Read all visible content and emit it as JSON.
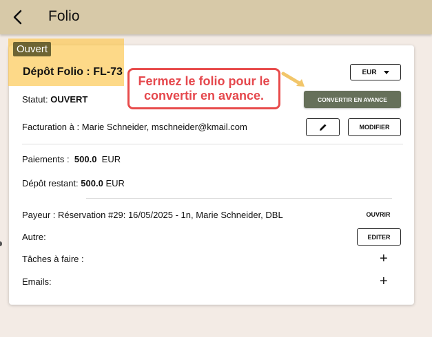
{
  "app": {
    "title": "Folio"
  },
  "card": {
    "status_badge": "Ouvert",
    "folio_title": "Dépôt Folio : FL-73",
    "currency": "EUR",
    "callout": "Fermez le folio pour le convertir en avance.",
    "convert_button": "CONVERTIR EN AVANCE",
    "statut_label": "Statut:",
    "statut_value": "OUVERT",
    "facturation": "Facturation à : Marie Schneider, mschneider@kmail.com",
    "modifier_button": "MODIFIER",
    "paiements_label": "Paiements :",
    "paiements_amount": "500.0",
    "paiements_currency": "EUR",
    "depot_label": "Dépôt restant:",
    "depot_amount": "500.0",
    "depot_currency": "EUR",
    "payeur_label": "Payeur :",
    "payeur_value": "Réservation #29: 16/05/2025 - 1n, Marie Schneider, DBL",
    "ouvrir_button": "OUVRIR",
    "autre_label": "Autre:",
    "editer_button": "EDITER",
    "taches_label": "Tâches à faire :",
    "emails_label": "Emails:",
    "plus": "+"
  },
  "colors": {
    "topbar": "#d7c9a8",
    "highlight": "#fcc448",
    "badge": "#6d6433",
    "callout_border": "#e84b4b",
    "convert_button": "#66705a"
  },
  "icons": {
    "back": "arrow-left-icon",
    "edit": "pencil-icon",
    "dropdown": "caret-down-icon",
    "add": "plus-icon"
  }
}
